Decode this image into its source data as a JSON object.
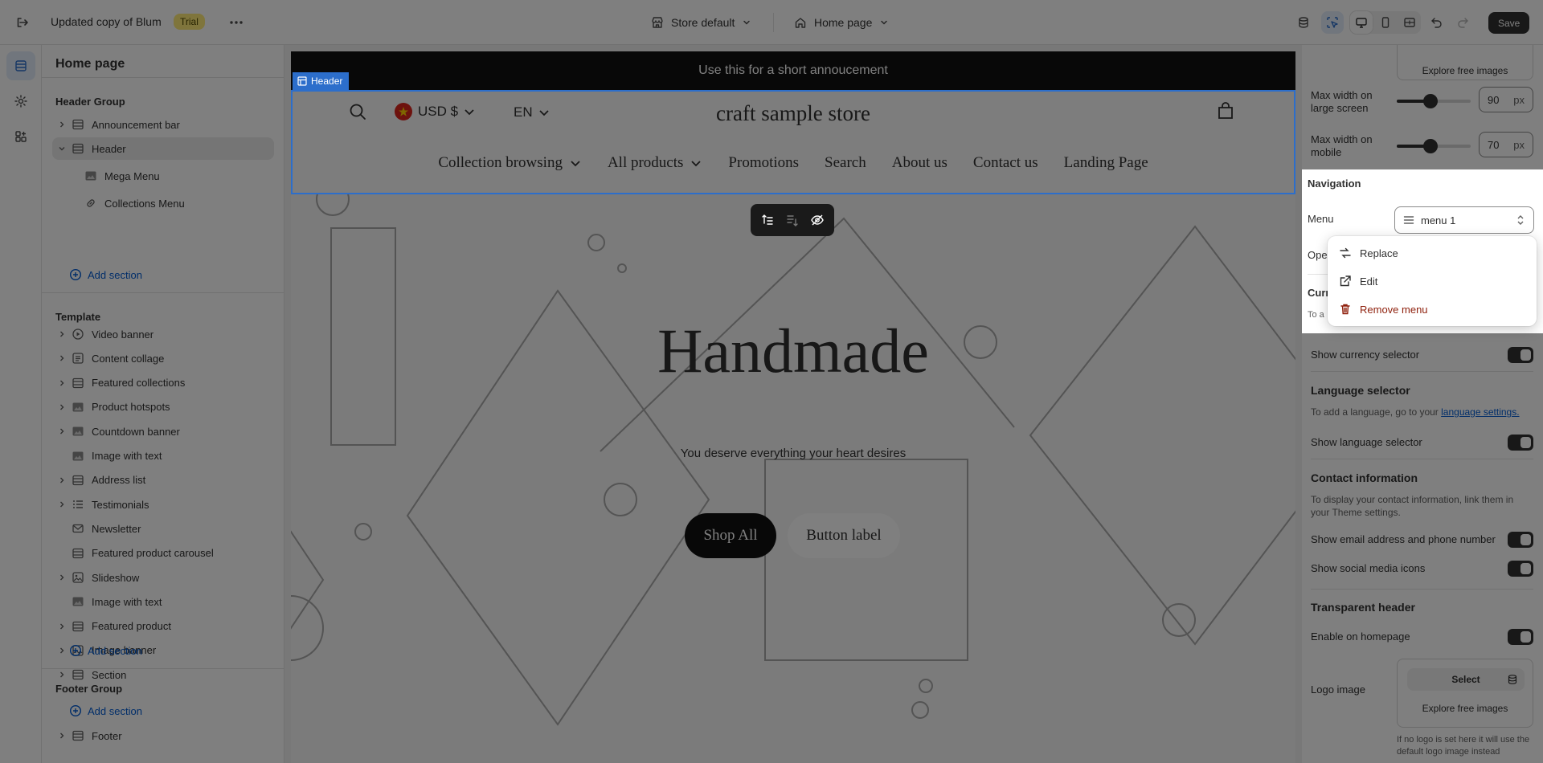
{
  "topbar": {
    "title": "Updated copy of Blum",
    "badge": "Trial",
    "store_selector": "Store default",
    "page_selector": "Home page",
    "save_label": "Save"
  },
  "sidebar": {
    "title": "Home page",
    "header_group": {
      "title": "Header Group",
      "items": [
        "Announcement bar",
        "Header",
        "Mega Menu",
        "Collections Menu"
      ],
      "add": "Add section"
    },
    "template": {
      "title": "Template",
      "items": [
        "Video banner",
        "Content collage",
        "Featured collections",
        "Product hotspots",
        "Countdown banner",
        "Image with text",
        "Address list",
        "Testimonials",
        "Newsletter",
        "Featured product carousel",
        "Slideshow",
        "Image with text",
        "Featured product",
        "Image banner",
        "Section"
      ],
      "add": "Add section"
    },
    "footer_group": {
      "title": "Footer Group",
      "add": "Add section",
      "items": [
        "Footer"
      ]
    }
  },
  "preview": {
    "announcement": "Use this for a short annoucement",
    "header_tag": "Header",
    "currency": "USD $",
    "language": "EN",
    "store_name": "craft sample store",
    "nav": [
      "Collection browsing",
      "All products",
      "Promotions",
      "Search",
      "About us",
      "Contact us",
      "Landing Page"
    ],
    "hero_title": "Handmade",
    "hero_subtitle": "You deserve everything your heart desires",
    "primary_button": "Shop All",
    "secondary_button": "Button label"
  },
  "settings": {
    "explore_top": "Explore free images",
    "max_large_label": "Max width on large screen",
    "max_large_value": "90",
    "max_large_fraction": 0.45,
    "max_mobile_label": "Max width on mobile",
    "max_mobile_value": "70",
    "max_mobile_fraction": 0.45,
    "unit": "px",
    "navigation_heading": "Navigation",
    "menu_label": "Menu",
    "menu_value": "menu 1",
    "open_partial": "Ope",
    "currency_partial": "Curr",
    "currency_help_partial": "To a",
    "show_currency": "Show currency selector",
    "language_heading": "Language selector",
    "language_help": "To add a language, go to your",
    "language_link": "language settings.",
    "show_language": "Show language selector",
    "contact_heading": "Contact information",
    "contact_help": "To display your contact information, link them in your Theme settings.",
    "show_email": "Show email address and phone number",
    "show_social": "Show social media icons",
    "transparent_heading": "Transparent header",
    "enable_homepage": "Enable on homepage",
    "logo_label": "Logo image",
    "select_label": "Select",
    "explore_bottom": "Explore free images",
    "logo_help": "If no logo is set here it will use the default logo image instead"
  },
  "menu_dropdown": {
    "replace": "Replace",
    "edit": "Edit",
    "remove": "Remove menu"
  },
  "colors": {
    "accent": "#005bd3",
    "selection_outline": "#2c6ecb",
    "danger": "#8e1f0b",
    "badge": "#ffeb78"
  }
}
